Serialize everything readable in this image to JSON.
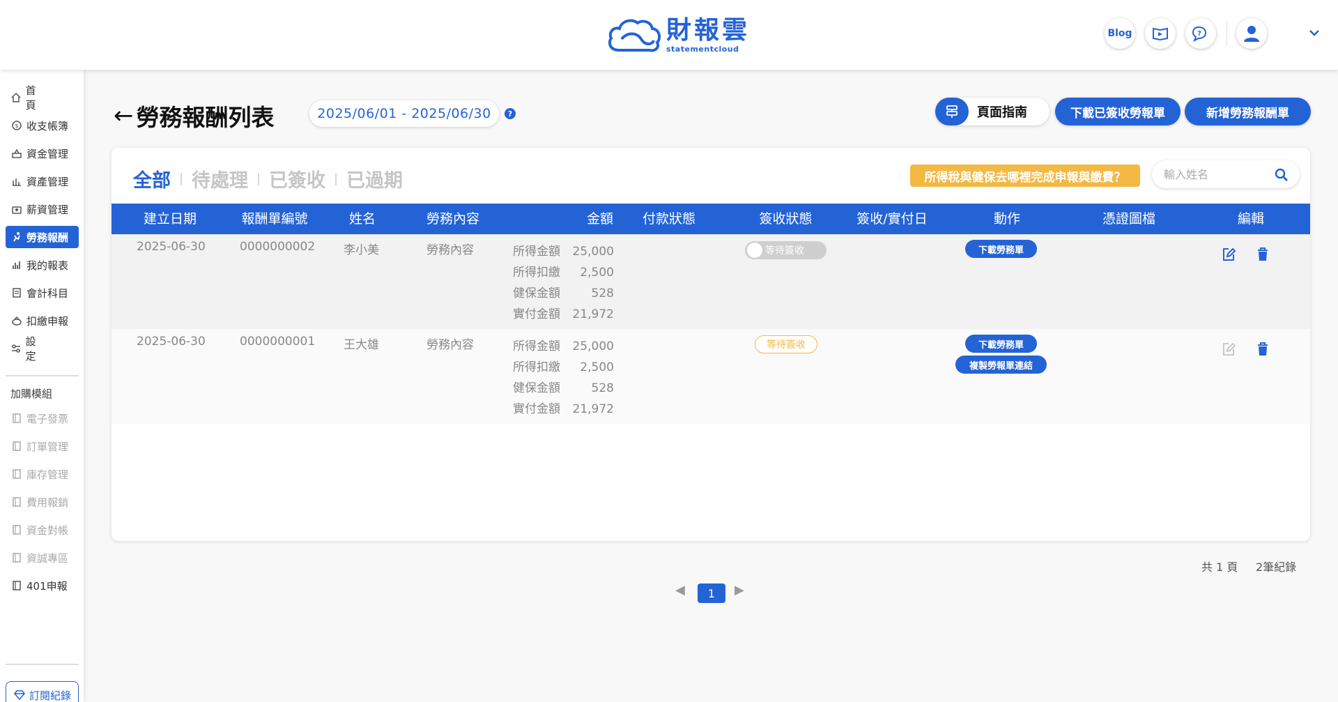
{
  "header": {
    "logo_title": "財報雲",
    "logo_sub": "statementcloud",
    "blog_label": "Blog"
  },
  "sidebar": {
    "items": [
      {
        "label": "首頁",
        "icon": "home-icon"
      },
      {
        "label": "收支帳簿",
        "icon": "ledger-icon"
      },
      {
        "label": "資金管理",
        "icon": "funds-icon"
      },
      {
        "label": "資產管理",
        "icon": "assets-icon"
      },
      {
        "label": "薪資管理",
        "icon": "salary-icon"
      },
      {
        "label": "勞務報酬",
        "icon": "labor-icon"
      },
      {
        "label": "我的報表",
        "icon": "report-icon"
      },
      {
        "label": "會計科目",
        "icon": "accounts-icon"
      },
      {
        "label": "扣繳申報",
        "icon": "withholding-icon"
      },
      {
        "label": "設定",
        "icon": "settings-icon"
      }
    ],
    "section_title": "加購模組",
    "addons": [
      {
        "label": "電子發票"
      },
      {
        "label": "訂單管理"
      },
      {
        "label": "庫存管理"
      },
      {
        "label": "費用報銷"
      },
      {
        "label": "資金對帳"
      },
      {
        "label": "資誠專區"
      },
      {
        "label": "401申報"
      }
    ],
    "subscription_label": "訂閱紀錄"
  },
  "page": {
    "back_arrow": "←",
    "title": "勞務報酬列表",
    "date_range": "2025/06/01 - 2025/06/30",
    "help": "?",
    "guide_label": "頁面指南",
    "download_signed_label": "下載已簽收勞報單",
    "add_label": "新增勞務報酬單"
  },
  "tabs": [
    {
      "label": "全部",
      "active": true
    },
    {
      "label": "待處理",
      "active": false
    },
    {
      "label": "已簽收",
      "active": false
    },
    {
      "label": "已過期",
      "active": false
    }
  ],
  "tax_notice": "所得稅與健保去哪裡完成申報與繳費？",
  "search": {
    "placeholder": "輸入姓名"
  },
  "table": {
    "columns": [
      "建立日期",
      "報酬單編號",
      "姓名",
      "勞務內容",
      "金額",
      "付款狀態",
      "簽收狀態",
      "簽收/實付日",
      "動作",
      "憑證圖檔",
      "編輯"
    ],
    "rows": [
      {
        "date": "2025-06-30",
        "number": "0000000002",
        "name": "李小美",
        "content": "勞務內容",
        "amounts": [
          {
            "label": "所得金額",
            "value": "25,000"
          },
          {
            "label": "所得扣繳",
            "value": "2,500"
          },
          {
            "label": "健保金額",
            "value": "528"
          },
          {
            "label": "實付金額",
            "value": "21,972"
          }
        ],
        "status": "等待簽收",
        "actions": [
          "下載勞務單"
        ]
      },
      {
        "date": "2025-06-30",
        "number": "0000000001",
        "name": "王大雄",
        "content": "勞務內容",
        "amounts": [
          {
            "label": "所得金額",
            "value": "25,000"
          },
          {
            "label": "所得扣繳",
            "value": "2,500"
          },
          {
            "label": "健保金額",
            "value": "528"
          },
          {
            "label": "實付金額",
            "value": "21,972"
          }
        ],
        "status": "等待簽收",
        "actions": [
          "下載勞務單",
          "複製勞報單連結"
        ]
      }
    ]
  },
  "pagination": {
    "total_pages": "共 1 頁",
    "total_records": "2筆紀錄",
    "current": "1",
    "prev": "◀",
    "next": "▶"
  },
  "colors": {
    "primary": "#2463d6",
    "warning": "#f4b943"
  }
}
